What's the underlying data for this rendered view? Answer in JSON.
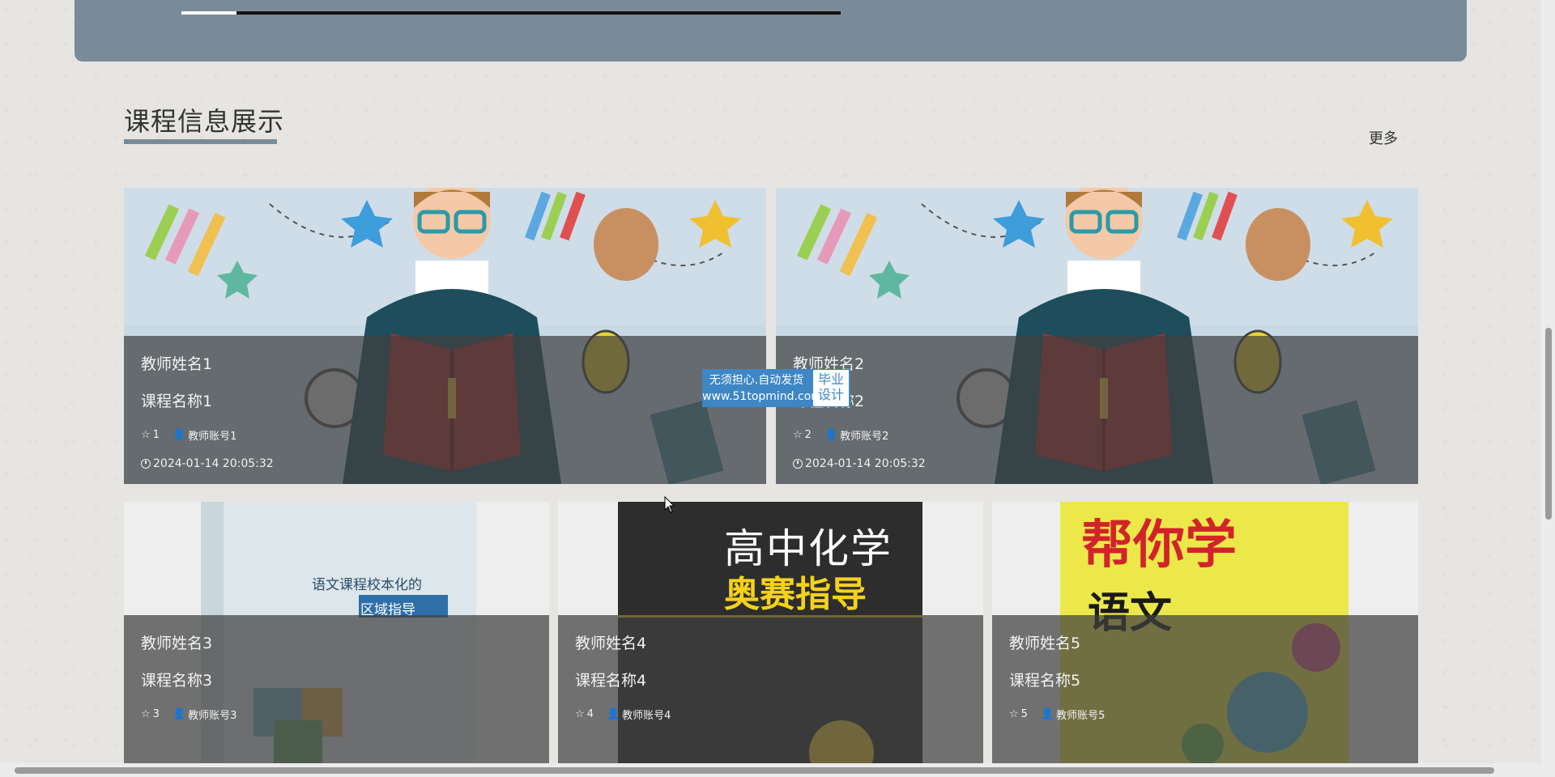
{
  "section": {
    "title": "课程信息展示",
    "more_label": "更多"
  },
  "cards": [
    {
      "teacher_name": "教师姓名1",
      "course_name": "课程名称1",
      "favorites": "1",
      "account": "教师账号1",
      "time": "2024-01-14 20:05:32",
      "image": "cartoon-teacher-reading"
    },
    {
      "teacher_name": "教师姓名2",
      "course_name": "课程名称2",
      "favorites": "2",
      "account": "教师账号2",
      "time": "2024-01-14 20:05:32",
      "image": "cartoon-teacher-reading"
    },
    {
      "teacher_name": "教师姓名3",
      "course_name": "课程名称3",
      "favorites": "3",
      "account": "教师账号3",
      "image": "book-cover-chinese-curriculum",
      "cover_text": [
        "语文课程校本化的",
        "区域指导"
      ]
    },
    {
      "teacher_name": "教师姓名4",
      "course_name": "课程名称4",
      "favorites": "4",
      "account": "教师账号4",
      "image": "book-cover-chemistry",
      "cover_text": [
        "高中化学",
        "奥赛指导"
      ]
    },
    {
      "teacher_name": "教师姓名5",
      "course_name": "课程名称5",
      "favorites": "5",
      "account": "教师账号5",
      "image": "book-cover-chinese-help",
      "cover_text": [
        "帮你学",
        "语文"
      ]
    }
  ],
  "watermark": {
    "line1": "无须担心.自动发货",
    "line2": "www.51topmind.com",
    "badge1": "毕业",
    "badge2": "设计"
  },
  "icons": {
    "favorite": "star-icon",
    "account": "user-icon",
    "time": "clock-icon"
  },
  "colors": {
    "accent": "#798b99",
    "overlay": "#404040",
    "watermark": "#3f86c4"
  }
}
